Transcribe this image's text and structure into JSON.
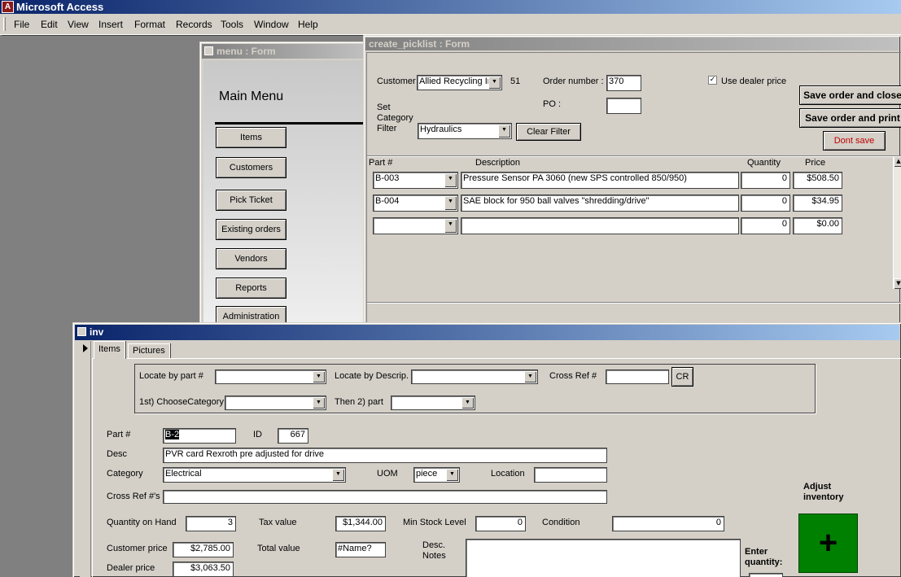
{
  "app": {
    "title": "Microsoft Access",
    "logo_letter": "A"
  },
  "menu": [
    "File",
    "Edit",
    "View",
    "Insert",
    "Format",
    "Records",
    "Tools",
    "Window",
    "Help"
  ],
  "menu_form": {
    "title": "menu : Form",
    "heading": "Main Menu",
    "buttons": [
      "Items",
      "Customers",
      "Pick Ticket",
      "Existing orders",
      "Vendors",
      "Reports",
      "Administration"
    ]
  },
  "picklist": {
    "title": "create_picklist : Form",
    "customer_label": "Customer",
    "customer_value": "Allied Recycling In",
    "customer_id": "51",
    "order_label": "Order number :",
    "order_value": "370",
    "po_label": "PO :",
    "po_value": "",
    "use_dealer_label": "Use dealer price",
    "use_dealer_checked": true,
    "filter_label_1": "Set",
    "filter_label_2": "Category",
    "filter_label_3": "Filter",
    "filter_value": "Hydraulics",
    "clear_filter": "Clear Filter",
    "save_close": "Save order and close",
    "save_print": "Save order and print",
    "dont_save": "Dont save",
    "columns": {
      "part": "Part #",
      "description": "Description",
      "quantity": "Quantity",
      "price": "Price"
    },
    "rows": [
      {
        "part": "B-003",
        "description": "Pressure Sensor PA 3060 (new SPS controlled 850/950)",
        "quantity": "0",
        "price": "$508.50"
      },
      {
        "part": "B-004",
        "description": "SAE block for 950 ball valves \"shredding/drive\"",
        "quantity": "0",
        "price": "$34.95"
      },
      {
        "part": "",
        "description": "",
        "quantity": "0",
        "price": "$0.00"
      }
    ]
  },
  "inv": {
    "title": "inv",
    "tabs": [
      "Items",
      "Pictures"
    ],
    "locate_part_label": "Locate by part #",
    "locate_desc_label": "Locate by Descrip.",
    "cross_ref_label": "Cross Ref #",
    "cr_button": "CR",
    "choose_cat_label": "1st) ChooseCategory",
    "then_part_label": "Then 2) part",
    "part_label": "Part #",
    "part_value": "B-2",
    "id_label": "ID",
    "id_value": "667",
    "desc_label": "Desc",
    "desc_value": "PVR card Rexroth pre adjusted for drive",
    "category_label": "Category",
    "category_value": "Electrical",
    "uom_label": "UOM",
    "uom_value": "piece",
    "location_label": "Location",
    "location_value": "",
    "crossrefs_label": "Cross Ref #'s",
    "crossrefs_value": "",
    "qoh_label": "Quantity on Hand",
    "qoh_value": "3",
    "tax_label": "Tax value",
    "tax_value": "$1,344.00",
    "min_label": "Min Stock Level",
    "min_value": "0",
    "cond_label": "Condition",
    "cond_value": "0",
    "cust_price_label": "Customer price",
    "cust_price_value": "$2,785.00",
    "total_label": "Total value",
    "total_value": "#Name?",
    "notes_label_1": "Desc.",
    "notes_label_2": "Notes",
    "dealer_label": "Dealer price",
    "dealer_value": "$3,063.50",
    "adjust_label_1": "Adjust",
    "adjust_label_2": "inventory",
    "enter_qty_1": "Enter",
    "enter_qty_2": "quantity:",
    "plus_symbol": "+",
    "plus_color": "#008000"
  }
}
